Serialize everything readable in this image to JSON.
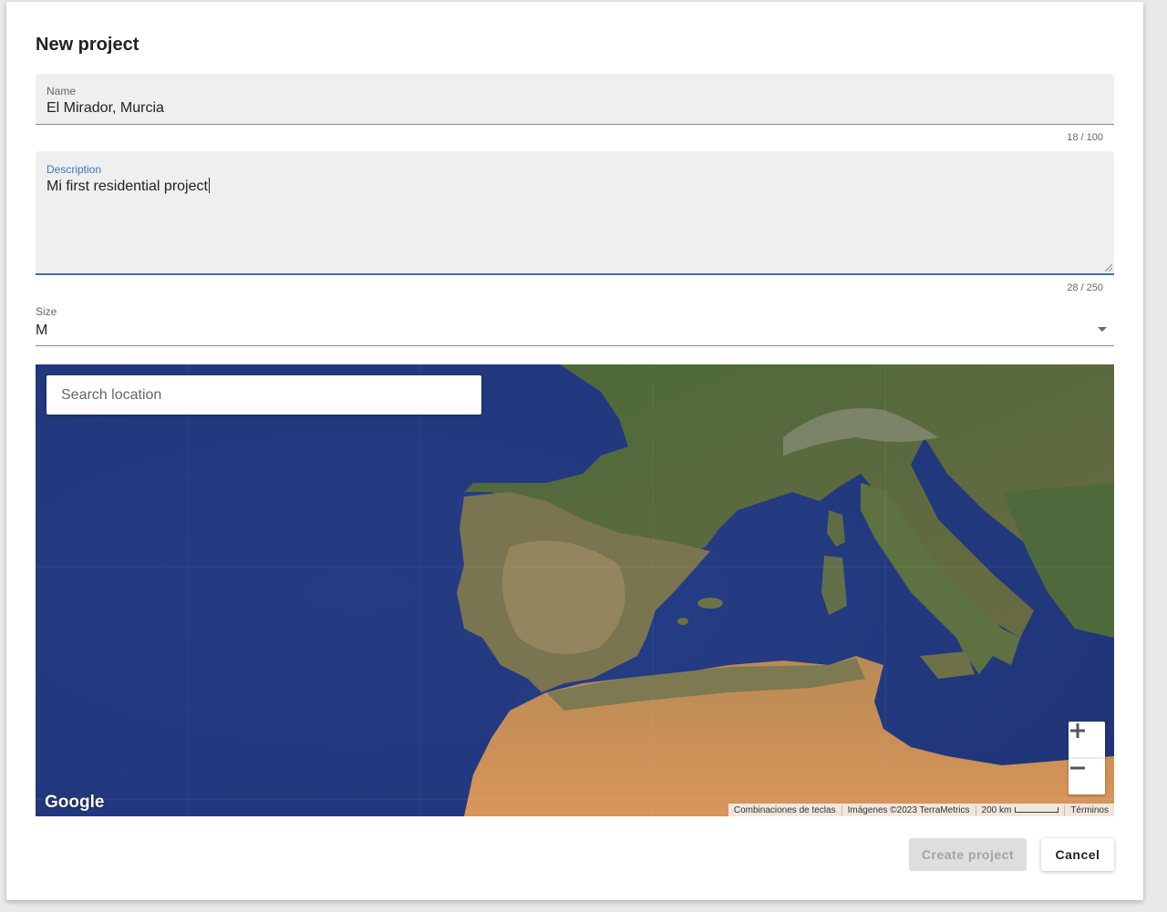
{
  "dialog": {
    "title": "New project"
  },
  "name_field": {
    "label": "Name",
    "value": "El Mirador, Murcia",
    "counter": "18 / 100"
  },
  "description_field": {
    "label": "Description",
    "value": "Mi first residential project",
    "counter": "28 / 250"
  },
  "size_select": {
    "label": "Size",
    "value": "M"
  },
  "map": {
    "search_placeholder": "Search location",
    "zoom_in_icon": "plus-icon",
    "zoom_out_icon": "minus-icon",
    "logo": "Google",
    "attribution": {
      "shortcuts": "Combinaciones de teclas",
      "imagery": "Imágenes ©2023 TerraMetrics",
      "scale": "200 km",
      "terms": "Términos"
    }
  },
  "actions": {
    "create_label": "Create project",
    "cancel_label": "Cancel"
  },
  "colors": {
    "accent": "#3a6fb0",
    "field_bg": "#efefef",
    "disabled_button_bg": "#dedede"
  }
}
